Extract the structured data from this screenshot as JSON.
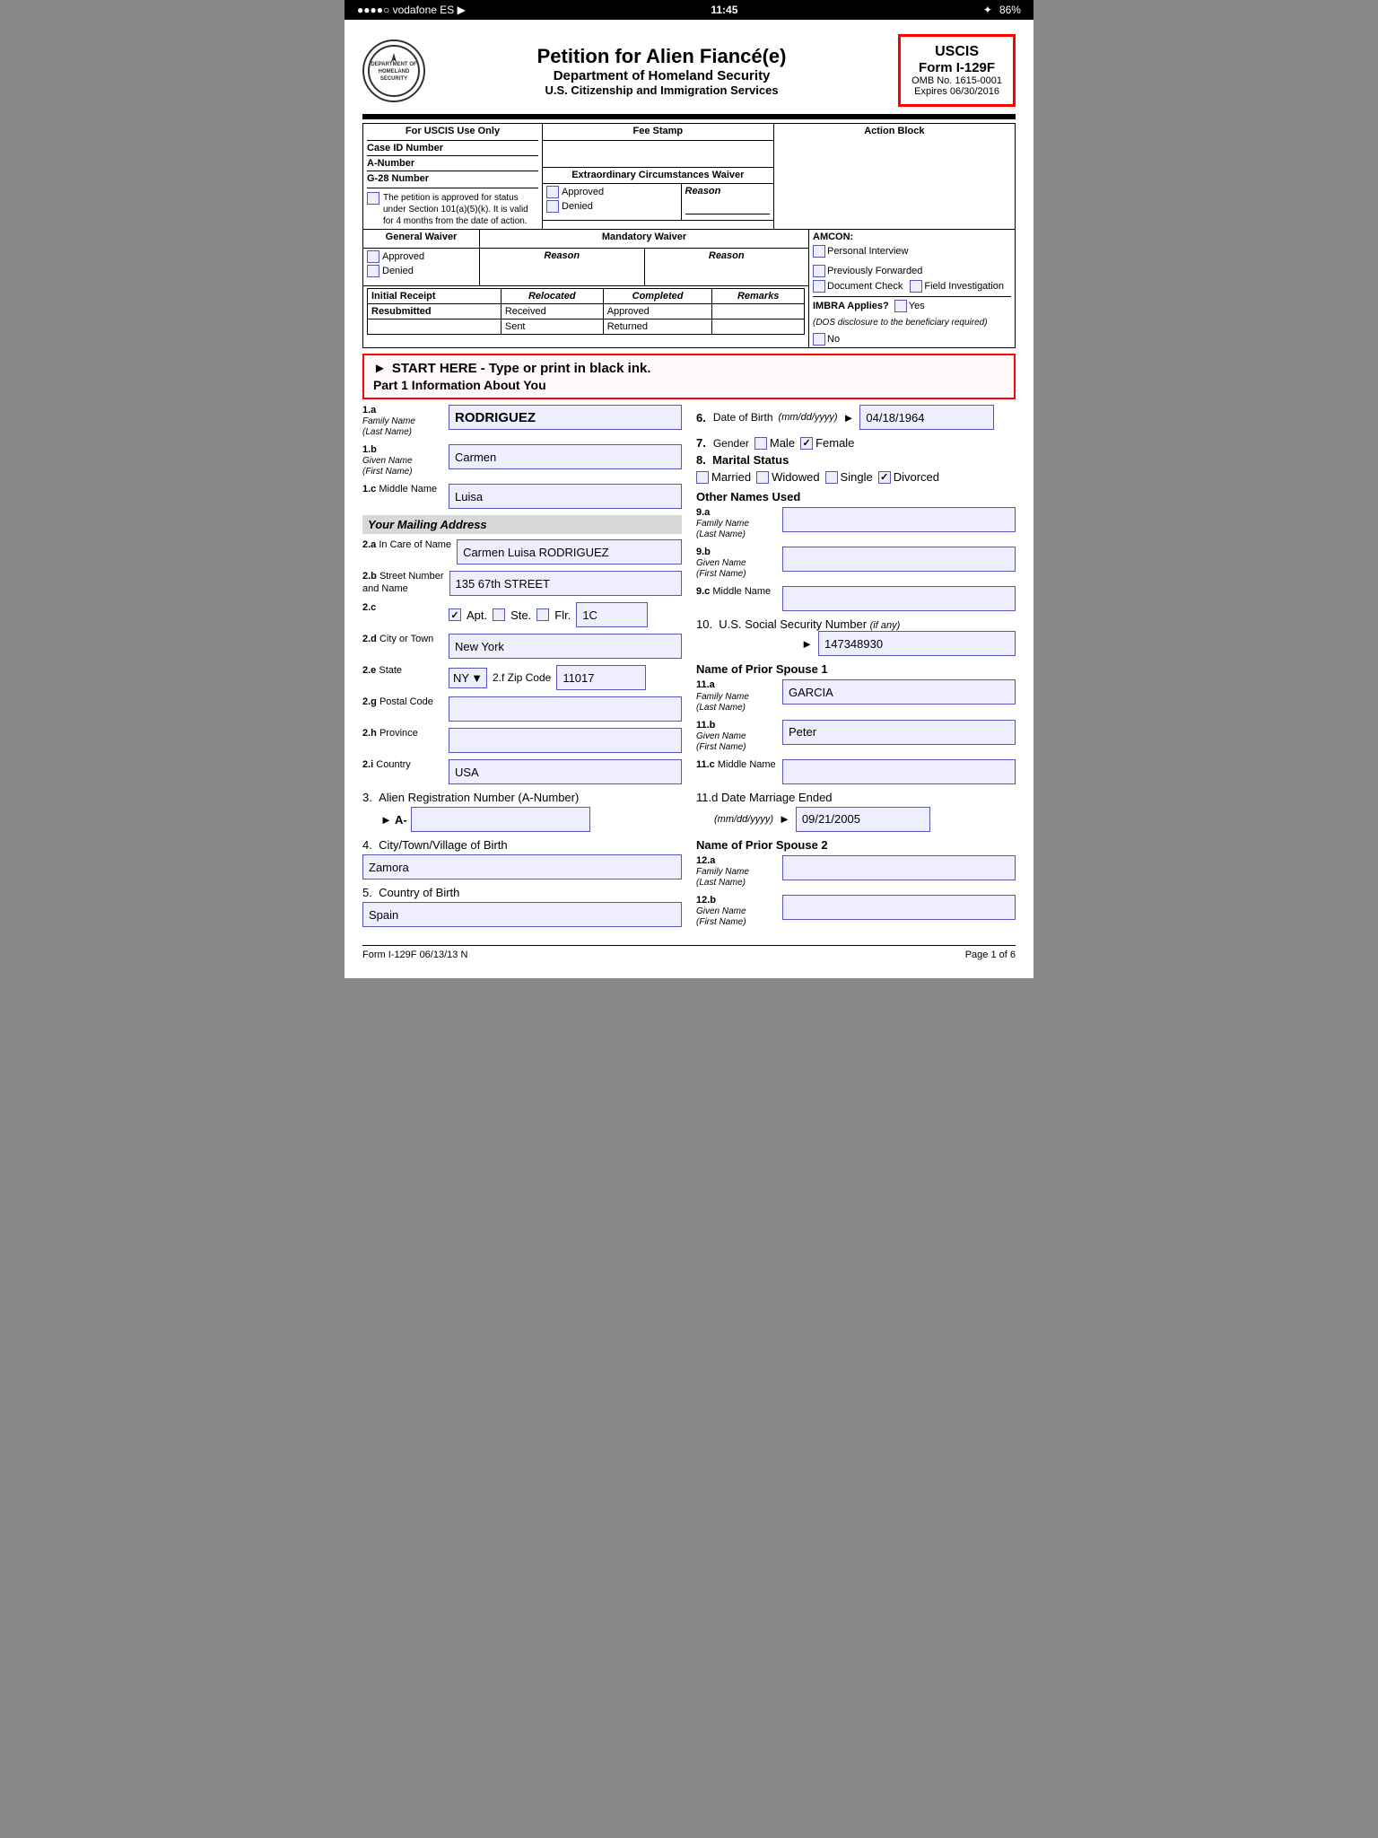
{
  "statusBar": {
    "left": "●●●●○ vodafone ES  ▶",
    "time": "11:45",
    "battery": "86%",
    "bt": "✦"
  },
  "header": {
    "title": "Petition for Alien Fiancé(e)",
    "subtitle": "Department of Homeland Security",
    "sub2": "U.S. Citizenship and Immigration Services",
    "uscis": {
      "title": "USCIS",
      "form": "Form I-129F",
      "omb": "OMB No. 1615-0001",
      "expires": "Expires 06/30/2016"
    }
  },
  "adminTable": {
    "forUscis": "For USCIS Use Only",
    "feeStamp": "Fee Stamp",
    "actionBlock": "Action Block",
    "caseId": "Case ID Number",
    "aNumber": "A-Number",
    "g28": "G-28 Number",
    "petitionText": "The petition is approved for status under Section 101(a)(5)(k). It is valid for 4 months from the date of action.",
    "extraCirc": "Extraordinary Circumstances Waiver",
    "reason": "Reason",
    "approved": "Approved",
    "denied": "Denied",
    "genWaiver": "General Waiver",
    "mandWaiver": "Mandatory Waiver",
    "amcon": "AMCON:",
    "personalInterview": "Personal Interview",
    "prevForwarded": "Previously Forwarded",
    "docCheck": "Document Check",
    "fieldInvestigation": "Field Investigation",
    "imbra": "IMBRA Applies?",
    "imbraYes": "Yes",
    "imbraNote": "(DOS disclosure to the beneficiary required)",
    "imbraNo": "No",
    "initialReceipt": "Initial Receipt",
    "relocated": "Relocated",
    "completed": "Completed",
    "remarks": "Remarks",
    "received": "Received",
    "approved2": "Approved",
    "resubmitted": "Resubmitted",
    "sent": "Sent",
    "returned": "Returned"
  },
  "startHere": {
    "arrow": "►",
    "text": "START HERE - Type or print in black ink.",
    "part1": "Part 1   Information About You"
  },
  "leftFields": {
    "field1a": {
      "num": "1.a",
      "label": "Family Name\n(Last Name)",
      "value": "RODRIGUEZ"
    },
    "field1b": {
      "num": "1.b",
      "label": "Given Name\n(First Name)",
      "value": "Carmen"
    },
    "field1c": {
      "num": "1.c",
      "label": "Middle Name",
      "value": "Luisa"
    },
    "mailingAddress": "Your Mailing Address",
    "field2a": {
      "num": "2.a",
      "label": "In Care of Name",
      "value": "Carmen Luisa RODRIGUEZ"
    },
    "field2b": {
      "num": "2.b",
      "label": "Street Number\nand Name",
      "value": "135 67th STREET"
    },
    "field2c": {
      "num": "2.c",
      "label": "Apt.",
      "apt_checked": true,
      "ste_label": "Ste.",
      "ste_checked": false,
      "flr_label": "Flr.",
      "flr_checked": false,
      "value": "1C"
    },
    "field2d": {
      "num": "2.d",
      "label": "City or Town",
      "value": "New York"
    },
    "field2e": {
      "num": "2.e",
      "label": "State",
      "value": "NY"
    },
    "field2f": {
      "num": "2.f",
      "label": "Zip Code",
      "value": "11017"
    },
    "field2g": {
      "num": "2.g",
      "label": "Postal Code",
      "value": ""
    },
    "field2h": {
      "num": "2.h",
      "label": "Province",
      "value": ""
    },
    "field2i": {
      "num": "2.i",
      "label": "Country",
      "value": "USA"
    },
    "field3": {
      "num": "3.",
      "label": "Alien Registration Number (A-Number)",
      "prefix": "► A-",
      "value": ""
    },
    "field4": {
      "num": "4.",
      "label": "City/Town/Village of Birth",
      "value": "Zamora"
    },
    "field5": {
      "num": "5.",
      "label": "Country of Birth",
      "value": "Spain"
    }
  },
  "rightFields": {
    "field6": {
      "num": "6.",
      "label": "Date of Birth",
      "hint": "(mm/dd/yyyy)",
      "value": "04/18/1964"
    },
    "field7": {
      "num": "7.",
      "label": "Gender",
      "male": false,
      "female": true
    },
    "field8": {
      "num": "8.",
      "label": "Marital Status",
      "married": false,
      "widowed": false,
      "single": false,
      "divorced": true
    },
    "field9a": {
      "num": "9.a",
      "label": "Family Name\n(Last Name)",
      "value": ""
    },
    "field9b": {
      "num": "9.b",
      "label": "Given Name\n(First Name)",
      "value": ""
    },
    "field9c": {
      "num": "9.c",
      "label": "Middle Name",
      "value": ""
    },
    "field10": {
      "num": "10.",
      "label": "U.S. Social Security Number",
      "hint": "(if any)",
      "value": "147348930"
    },
    "priorSpouse1": "Name of Prior Spouse 1",
    "field11a": {
      "num": "11.a",
      "label": "Family Name\n(Last Name)",
      "value": "GARCIA"
    },
    "field11b": {
      "num": "11.b",
      "label": "Given Name\n(First Name)",
      "value": "Peter"
    },
    "field11c": {
      "num": "11.c",
      "label": "Middle Name",
      "value": ""
    },
    "field11d": {
      "num": "11.d",
      "label": "Date Marriage Ended",
      "hint": "(mm/dd/yyyy)",
      "value": "09/21/2005"
    },
    "priorSpouse2": "Name of Prior Spouse 2",
    "field12a": {
      "num": "12.a",
      "label": "Family Name\n(Last Name)",
      "value": ""
    },
    "field12b": {
      "num": "12.b",
      "label": "Given Name\n(First Name)",
      "value": ""
    }
  },
  "footer": {
    "left": "Form I-129F  06/13/13 N",
    "right": "Page 1 of 6"
  }
}
